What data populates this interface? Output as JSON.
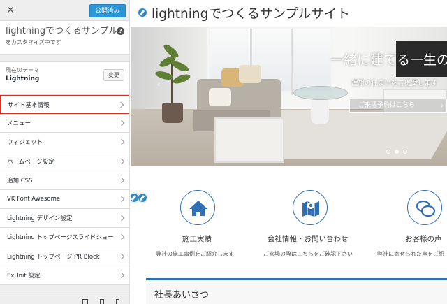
{
  "topbar": {
    "close_icon": "close-icon",
    "publish_label": "公開済み"
  },
  "customizer": {
    "site_title": "lightningでつくるサンプルサイト",
    "customizing_label": "をカスタマイズ中です",
    "help_icon": "help-icon",
    "help_glyph": "?"
  },
  "theme": {
    "current_label": "現在のテーマ",
    "name": "Lightning",
    "change_label": "変更"
  },
  "menu": {
    "items": [
      {
        "label": "サイト基本情報",
        "active": true
      },
      {
        "label": "メニュー"
      },
      {
        "label": "ウィジェット"
      },
      {
        "label": "ホームページ設定"
      },
      {
        "label": "追加 CSS"
      },
      {
        "label": "VK Font Awesome"
      },
      {
        "label": "Lightning デザイン設定"
      },
      {
        "label": "Lightning トップページスライドショー"
      },
      {
        "label": "Lightning トップページ PR Block"
      },
      {
        "label": "ExUnit 設定"
      }
    ]
  },
  "preview": {
    "site_title": "lightningでつくるサンプルサイト",
    "hero": {
      "catch": "一緒に建てる一生の",
      "sub": "理想の住まいをご提案します",
      "button_label": "ご来場予約はこちら",
      "arrow": "›",
      "prev_arrow": "‹"
    },
    "services": [
      {
        "title": "施工実績",
        "desc": "弊社の施工事例をご紹介します",
        "icon": "home-icon"
      },
      {
        "title": "会社情報・お問い合わせ",
        "desc": "ご来場の際はこちらをご確認下さい",
        "icon": "map-icon"
      },
      {
        "title": "お客様の声",
        "desc": "弊社に寄せられた声をご紹",
        "icon": "comments-icon"
      }
    ],
    "section_title": "社長あいさつ"
  },
  "colors": {
    "accent": "#2e6fb6",
    "publish": "#2b96d6",
    "active_border": "#d93025"
  }
}
